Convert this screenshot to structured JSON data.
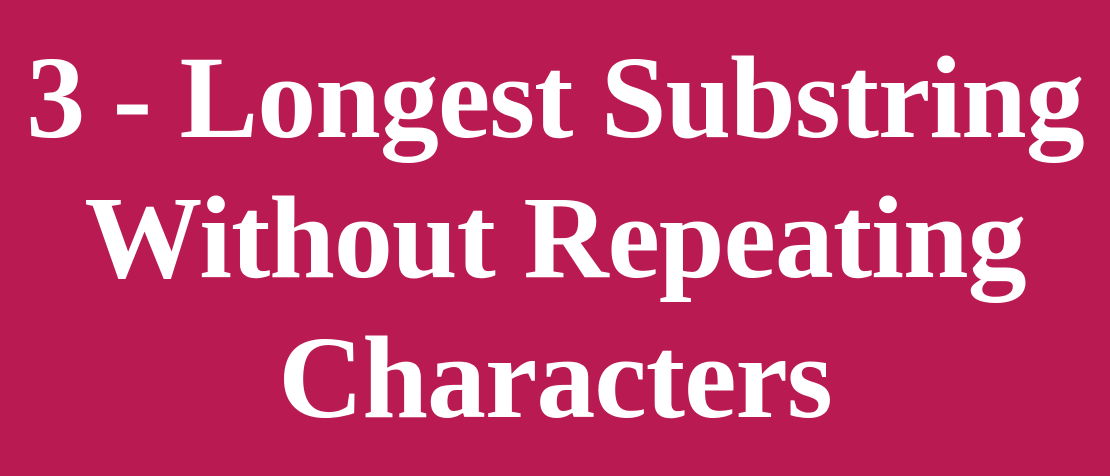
{
  "banner": {
    "background_color": "#ba1a52",
    "text_color": "#ffffff",
    "title_lines": [
      "3 - Longest Substring",
      "Without Repeating",
      "Characters"
    ]
  }
}
